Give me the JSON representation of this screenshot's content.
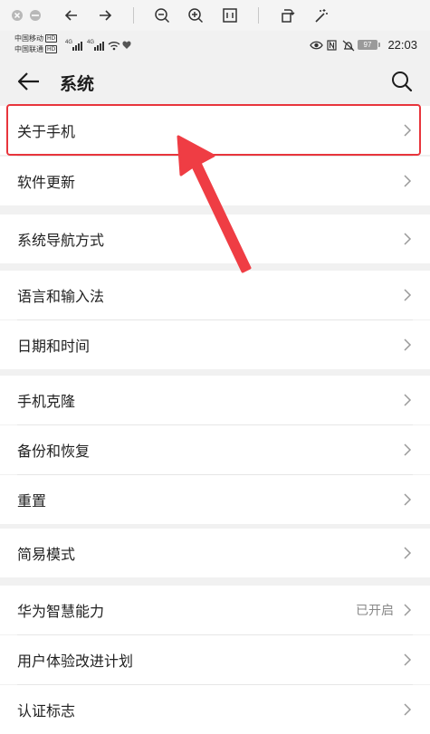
{
  "status_bar": {
    "carrier1": "中国移动",
    "carrier2": "中国联通",
    "hd": "HD",
    "battery": "97",
    "time": "22:03"
  },
  "header": {
    "title": "系统"
  },
  "sections": [
    {
      "items": [
        {
          "label": "关于手机"
        },
        {
          "label": "软件更新"
        }
      ]
    },
    {
      "items": [
        {
          "label": "系统导航方式"
        }
      ]
    },
    {
      "items": [
        {
          "label": "语言和输入法"
        },
        {
          "label": "日期和时间"
        }
      ]
    },
    {
      "items": [
        {
          "label": "手机克隆"
        },
        {
          "label": "备份和恢复"
        },
        {
          "label": "重置"
        }
      ]
    },
    {
      "items": [
        {
          "label": "简易模式"
        }
      ]
    },
    {
      "items": [
        {
          "label": "华为智慧能力",
          "value": "已开启"
        },
        {
          "label": "用户体验改进计划"
        },
        {
          "label": "认证标志"
        }
      ]
    }
  ],
  "colors": {
    "highlight": "#e8353c",
    "arrow": "#ef3d44"
  }
}
